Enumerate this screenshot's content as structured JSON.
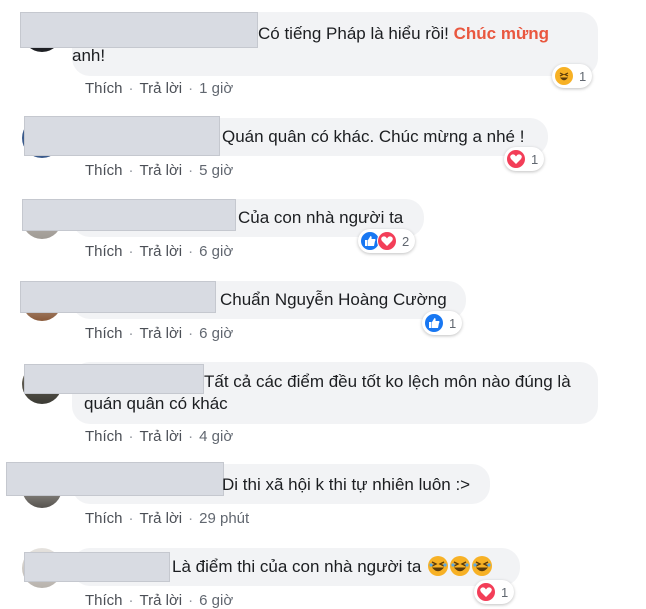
{
  "actions": {
    "like": "Thích",
    "reply": "Trả lời",
    "separator": "·"
  },
  "colors": {
    "bubble": "#f2f3f5",
    "highlight": "#e9573f",
    "like": "#1877f2",
    "love": "#f33e58",
    "haha": "#f7b125"
  },
  "comments": [
    {
      "text": "Có tiếng Pháp là hiểu rồi! ",
      "highlight": "Chúc mừng",
      "text2": "anh!",
      "time": "1 giờ",
      "reactions": [
        "haha"
      ],
      "reaction_count": "1"
    },
    {
      "text": "Quán quân có khác. Chúc mừng a nhé !",
      "time": "5 giờ",
      "reactions": [
        "love"
      ],
      "reaction_count": "1"
    },
    {
      "text": "Của con nhà người ta",
      "time": "6 giờ",
      "reactions": [
        "like",
        "love"
      ],
      "reaction_count": "2"
    },
    {
      "text": "Chuẩn Nguyễn Hoàng Cường",
      "time": "6 giờ",
      "reactions": [
        "like"
      ],
      "reaction_count": "1"
    },
    {
      "text": "Tất cả các điểm đều tốt ko lệch môn nào đúng là",
      "text2": "quán quân có khác",
      "time": "4 giờ"
    },
    {
      "text": "Di thi xã hội k thi tự nhiên luôn :>",
      "time": "29 phút"
    },
    {
      "text": "Là điểm thi của con nhà người ta",
      "emojis": [
        "haha",
        "haha",
        "haha"
      ],
      "time": "6 giờ",
      "reactions": [
        "love"
      ],
      "reaction_count": "1"
    }
  ]
}
